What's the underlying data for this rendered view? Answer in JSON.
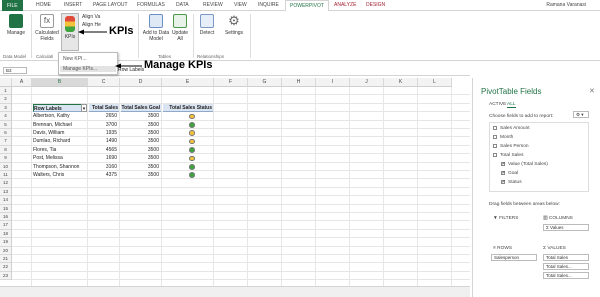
{
  "ribbon": {
    "tabs": [
      "FILE",
      "HOME",
      "INSERT",
      "PAGE LAYOUT",
      "FORMULAS",
      "DATA",
      "REVIEW",
      "VIEW",
      "INQUIRE",
      "POWERPIVOT",
      "ANALYZE",
      "DESIGN"
    ],
    "user": "Ramana Varanasi",
    "buttons": {
      "manage": "Manage",
      "calculated_fields": "Calculated Fields",
      "kpis": "KPIs",
      "add_to_data_model": "Add to Data Model",
      "update_all": "Update All",
      "detect": "Detect",
      "settings": "Settings",
      "align_1": "Align Va",
      "align_2": "Align He"
    },
    "groups": {
      "data_model": "Data Model",
      "calculations": "Calculati",
      "tables": "Tables",
      "relationships": "Relationships"
    },
    "kpi_menu": {
      "new_kpi": "New KPI...",
      "manage_kpis": "Manage KPIs..."
    }
  },
  "annotations": {
    "kpis": "KPIs",
    "manage_kpis": "Manage KPIs"
  },
  "formula_bar": {
    "name_box": "B3",
    "value": "Row Labels"
  },
  "grid": {
    "columns": [
      "A",
      "B",
      "C",
      "D",
      "E",
      "F",
      "G",
      "H",
      "I",
      "J",
      "K",
      "L"
    ],
    "rows": [
      "1",
      "2",
      "3",
      "4",
      "5",
      "6",
      "7",
      "8",
      "9",
      "10",
      "11",
      "12",
      "13",
      "14",
      "15",
      "16",
      "17",
      "18",
      "19",
      "20",
      "21",
      "22",
      "23"
    ],
    "headers": [
      "Row Labels",
      "Total Sales",
      "Total Sales Goal",
      "Total Sales Status"
    ],
    "data": [
      {
        "name": "Albertson, Kathy",
        "sales": "2650",
        "goal": "3500",
        "status": "yellow"
      },
      {
        "name": "Brennan, Michael",
        "sales": "3700",
        "goal": "3500",
        "status": "green"
      },
      {
        "name": "Davis, William",
        "sales": "1935",
        "goal": "3500",
        "status": "yellow"
      },
      {
        "name": "Dumlao, Richard",
        "sales": "1490",
        "goal": "3500",
        "status": "yellow"
      },
      {
        "name": "Flores, Tia",
        "sales": "4565",
        "goal": "3500",
        "status": "green"
      },
      {
        "name": "Post, Melissa",
        "sales": "1690",
        "goal": "3500",
        "status": "yellow"
      },
      {
        "name": "Thompson, Shannon",
        "sales": "3160",
        "goal": "3500",
        "status": "green"
      },
      {
        "name": "Walters, Chris",
        "sales": "4375",
        "goal": "3500",
        "status": "green"
      }
    ]
  },
  "status_colors": {
    "green": "#3fa33f",
    "yellow": "#f3c23a"
  },
  "pivot": {
    "title": "PivotTable Fields",
    "tabs": {
      "active": "ACTIVE",
      "all": "ALL"
    },
    "choose_label": "Choose fields to add to report:",
    "fields": [
      {
        "label": "Sales Amount",
        "checked": false,
        "indent": 0
      },
      {
        "label": "Month",
        "checked": false,
        "indent": 0
      },
      {
        "label": "Sales Person",
        "checked": false,
        "indent": 0
      },
      {
        "label": "Total Sales",
        "checked": false,
        "indent": 0
      },
      {
        "label": "Value (Total Sales)",
        "checked": true,
        "indent": 1
      },
      {
        "label": "Goal",
        "checked": true,
        "indent": 1
      },
      {
        "label": "Status",
        "checked": true,
        "indent": 1
      }
    ],
    "drag_label": "Drag fields between areas below:",
    "filters": "FILTERS",
    "columns": "COLUMNS",
    "columns_item": "Σ Values",
    "rows": "ROWS",
    "rows_item": "Salesperson",
    "values": "VALUES",
    "values_items": [
      "Total Sales",
      "Total Sales...",
      "Total Sales..."
    ]
  }
}
